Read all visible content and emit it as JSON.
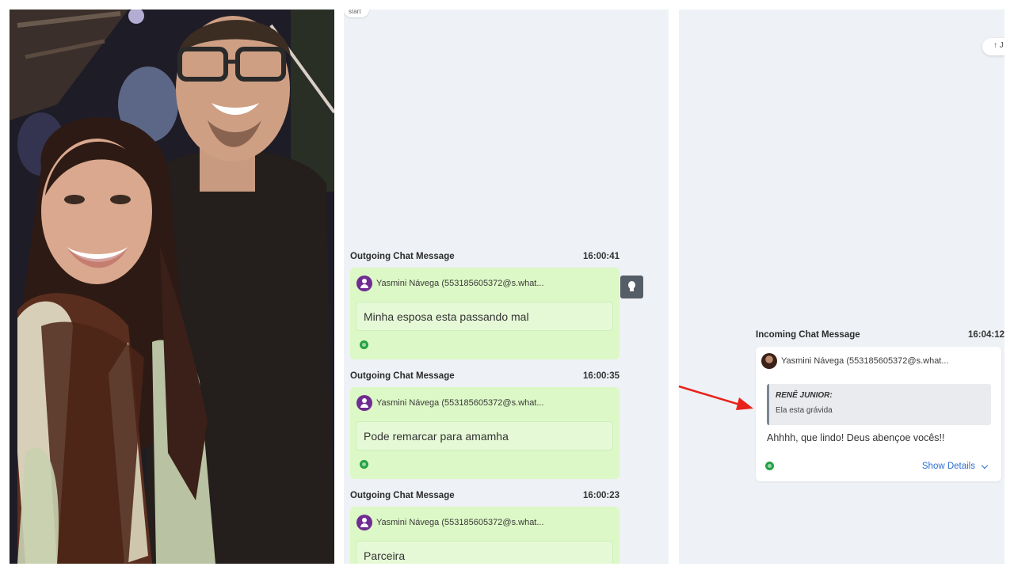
{
  "top_chip": "start",
  "jump_button": "↑ J",
  "outgoing": [
    {
      "header": "Outgoing Chat Message",
      "time": "16:00:41",
      "sender": "Yasmini Návega (553185605372@s.what...",
      "text": "Minha esposa esta passando mal"
    },
    {
      "header": "Outgoing Chat Message",
      "time": "16:00:35",
      "sender": "Yasmini Návega (553185605372@s.what...",
      "text": "Pode remarcar para amamha"
    },
    {
      "header": "Outgoing Chat Message",
      "time": "16:00:23",
      "sender": "Yasmini Návega (553185605372@s.what...",
      "text": "Parceira"
    }
  ],
  "incoming": {
    "header": "Incoming Chat Message",
    "time": "16:04:12",
    "sender": "Yasmini Návega (553185605372@s.what...",
    "quote_author": "RENÊ JUNIOR:",
    "quote_text": "Ela esta grávida",
    "text": "Ahhhh, que lindo! Deus abençoe vocês!!",
    "show_details": "Show Details"
  },
  "colors": {
    "outgoing_card": "#dcf8c6",
    "avatar": "#6f2c91",
    "whatsapp": "#25a244",
    "link": "#2f6fd0",
    "arrow": "#e8221b"
  },
  "icons": [
    "user-avatar-icon",
    "whatsapp-icon",
    "lightbulb-icon",
    "chevron-down-icon",
    "red-arrow-annotation"
  ]
}
